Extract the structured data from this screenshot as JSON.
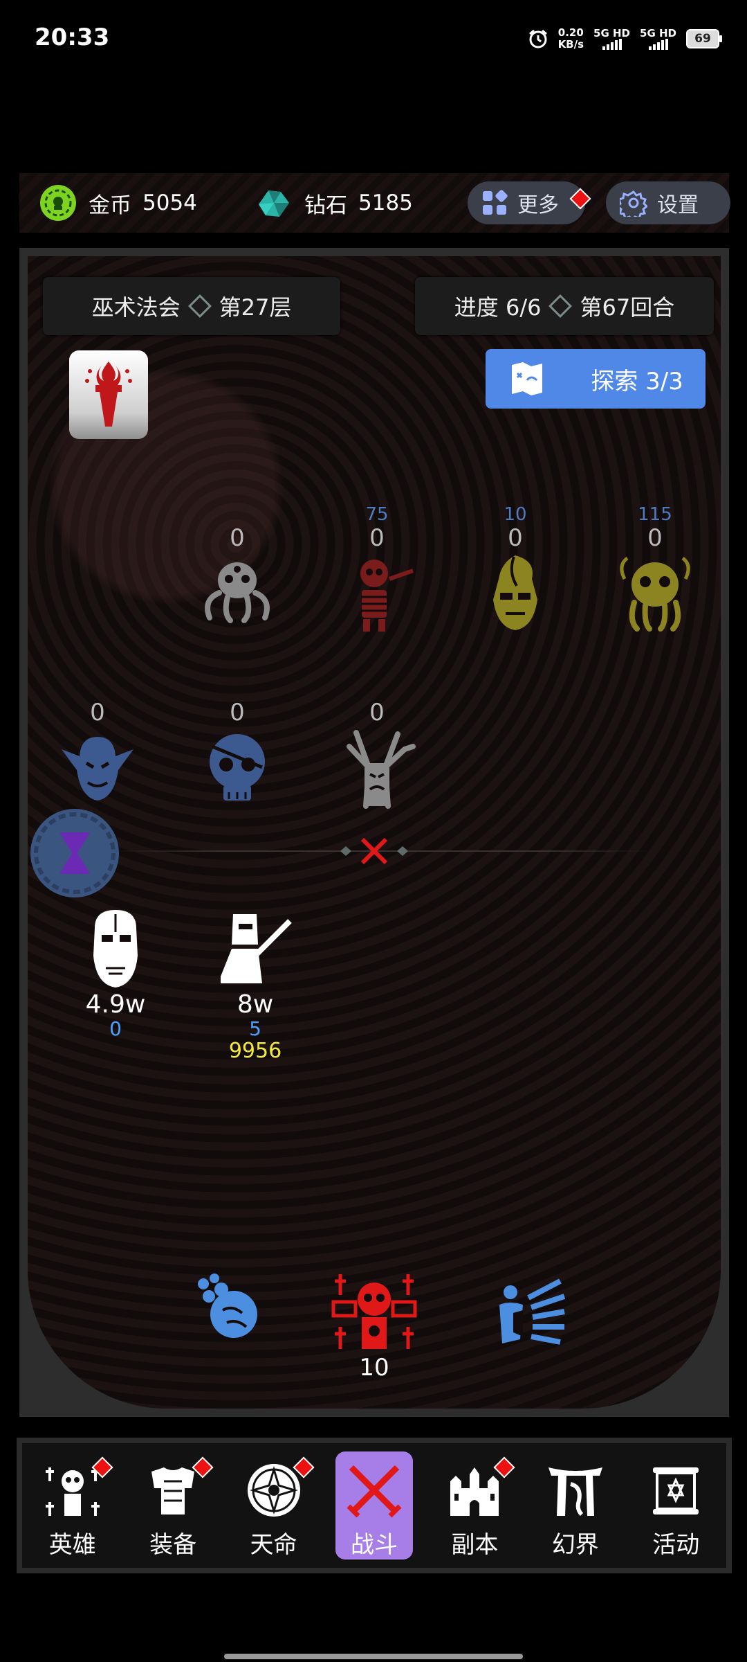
{
  "status_bar": {
    "time": "20:33",
    "net_speed_value": "0.20",
    "net_speed_unit": "KB/s",
    "sim1": "5G HD",
    "sim2": "5G HD",
    "battery": "69",
    "alarm_icon": "alarm-clock-icon"
  },
  "resources": {
    "gold_label": "金币",
    "gold_value": "5054",
    "diamond_label": "钻石",
    "diamond_value": "5185",
    "more_label": "更多",
    "settings_label": "设置"
  },
  "battle": {
    "dungeon_name": "巫术法会",
    "floor": "第27层",
    "progress": "进度 6/6",
    "round": "第67回合",
    "explore_label": "探索 3/3",
    "enemies": [
      {
        "name": "octopus",
        "value": "0",
        "top_label": "",
        "color": "#8a8a8a"
      },
      {
        "name": "skeleton-warrior",
        "value": "0",
        "top_label": "75",
        "color": "#7a1c1c"
      },
      {
        "name": "tribal-mask",
        "value": "0",
        "top_label": "10",
        "color": "#8c8420"
      },
      {
        "name": "cthulhu",
        "value": "0",
        "top_label": "115",
        "color": "#8c8420"
      },
      {
        "name": "vampire",
        "value": "0",
        "top_label": "",
        "color": "#3c5a8f"
      },
      {
        "name": "pirate-skull",
        "value": "0",
        "top_label": "",
        "color": "#3c5a8f"
      },
      {
        "name": "evil-tree",
        "value": "0",
        "top_label": "",
        "color": "#8a8a8a"
      }
    ],
    "heroes": [
      {
        "name": "cyborg-face",
        "main": "4.9w",
        "blue": "0",
        "yellow": ""
      },
      {
        "name": "knight",
        "main": "8w",
        "blue": "5",
        "yellow": "9956"
      }
    ],
    "skills": [
      {
        "name": "fireball-skill",
        "color": "#4c8ee0"
      },
      {
        "name": "death-totem-skill",
        "color": "#e01818",
        "count": "10"
      },
      {
        "name": "shield-bash-skill",
        "color": "#4c8ee0"
      }
    ]
  },
  "nav": [
    {
      "label": "英雄",
      "dot": true
    },
    {
      "label": "装备",
      "dot": true
    },
    {
      "label": "天命",
      "dot": true
    },
    {
      "label": "战斗",
      "dot": false,
      "active": true
    },
    {
      "label": "副本",
      "dot": true
    },
    {
      "label": "幻界",
      "dot": false
    },
    {
      "label": "活动",
      "dot": false
    }
  ]
}
